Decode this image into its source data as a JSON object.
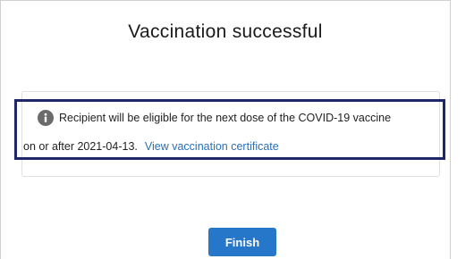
{
  "header": {
    "title": "Vaccination successful"
  },
  "info": {
    "icon": "info-icon",
    "message_line1": "Recipient will be eligible for the next dose of the COVID-19 vaccine",
    "message_line2": "on or after 2021-04-13.",
    "link_label": "View vaccination certificate"
  },
  "actions": {
    "finish_label": "Finish"
  },
  "colors": {
    "accent": "#2677c9",
    "link": "#2a6fb5",
    "highlight_border": "#1f2768",
    "icon": "#6b6b6b"
  }
}
